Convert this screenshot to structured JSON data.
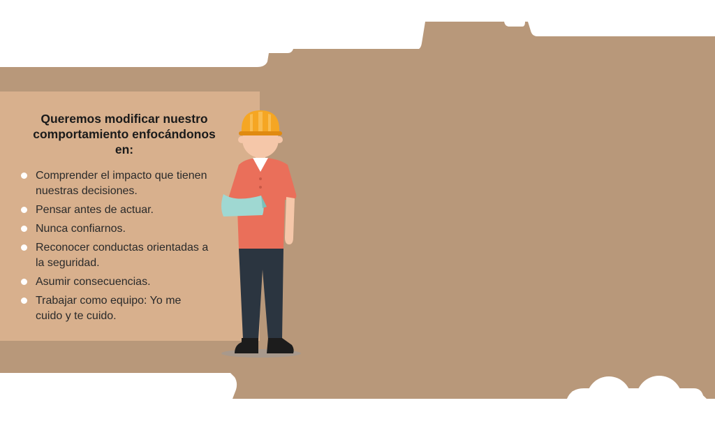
{
  "colors": {
    "background_panel": "#b8987a",
    "card": "#d8b08d",
    "text": "#1a1a1a",
    "bullet": "#ffffff",
    "helmet": "#f5a623",
    "shirt": "#ea6f5a",
    "sling": "#9fd8d2",
    "pants": "#2b3540",
    "skin": "#f5c7a9"
  },
  "card": {
    "title": "Queremos modificar nuestro comportamiento enfocándonos en:",
    "items": [
      {
        "text": "Comprender el impacto que tienen nuestras decisiones."
      },
      {
        "text": "Pensar antes de actuar."
      },
      {
        "text": "Nunca confiarnos."
      },
      {
        "text": "Reconocer conductas orientadas a la seguridad."
      },
      {
        "text": "Asumir consecuencias."
      },
      {
        "text": "Trabajar como equipo: Yo me cuido y te cuido."
      }
    ]
  },
  "illustration": {
    "icon": "injured-worker-with-arm-sling-icon"
  }
}
